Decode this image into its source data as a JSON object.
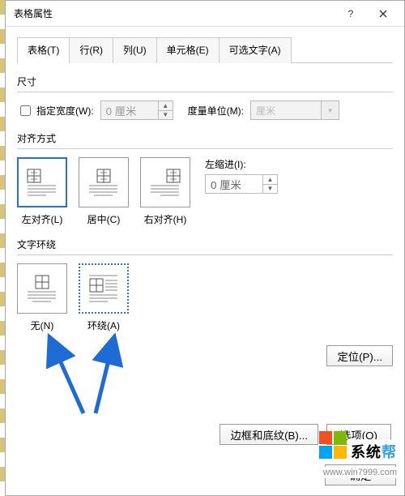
{
  "title": "表格属性",
  "tabs": [
    "表格(T)",
    "行(R)",
    "列(U)",
    "单元格(E)",
    "可选文字(A)"
  ],
  "size": {
    "label": "尺寸",
    "chk": "指定宽度(W):",
    "width_value": "0 厘米",
    "measure_label": "度量单位(M):",
    "unit_value": "厘米"
  },
  "align": {
    "label": "对齐方式",
    "options": [
      "左对齐(L)",
      "居中(C)",
      "右对齐(H)"
    ],
    "indent_label": "左缩进(I):",
    "indent_value": "0 厘米"
  },
  "wrap": {
    "label": "文字环绕",
    "options": [
      "无(N)",
      "环绕(A)"
    ]
  },
  "buttons": {
    "positioning": "定位(P)...",
    "borders": "边框和底纹(B)...",
    "options": "选项(O)",
    "ok": "确定"
  },
  "watermark": {
    "brand1": "系统",
    "brand2": "帮",
    "url": "www.win7999.com"
  }
}
